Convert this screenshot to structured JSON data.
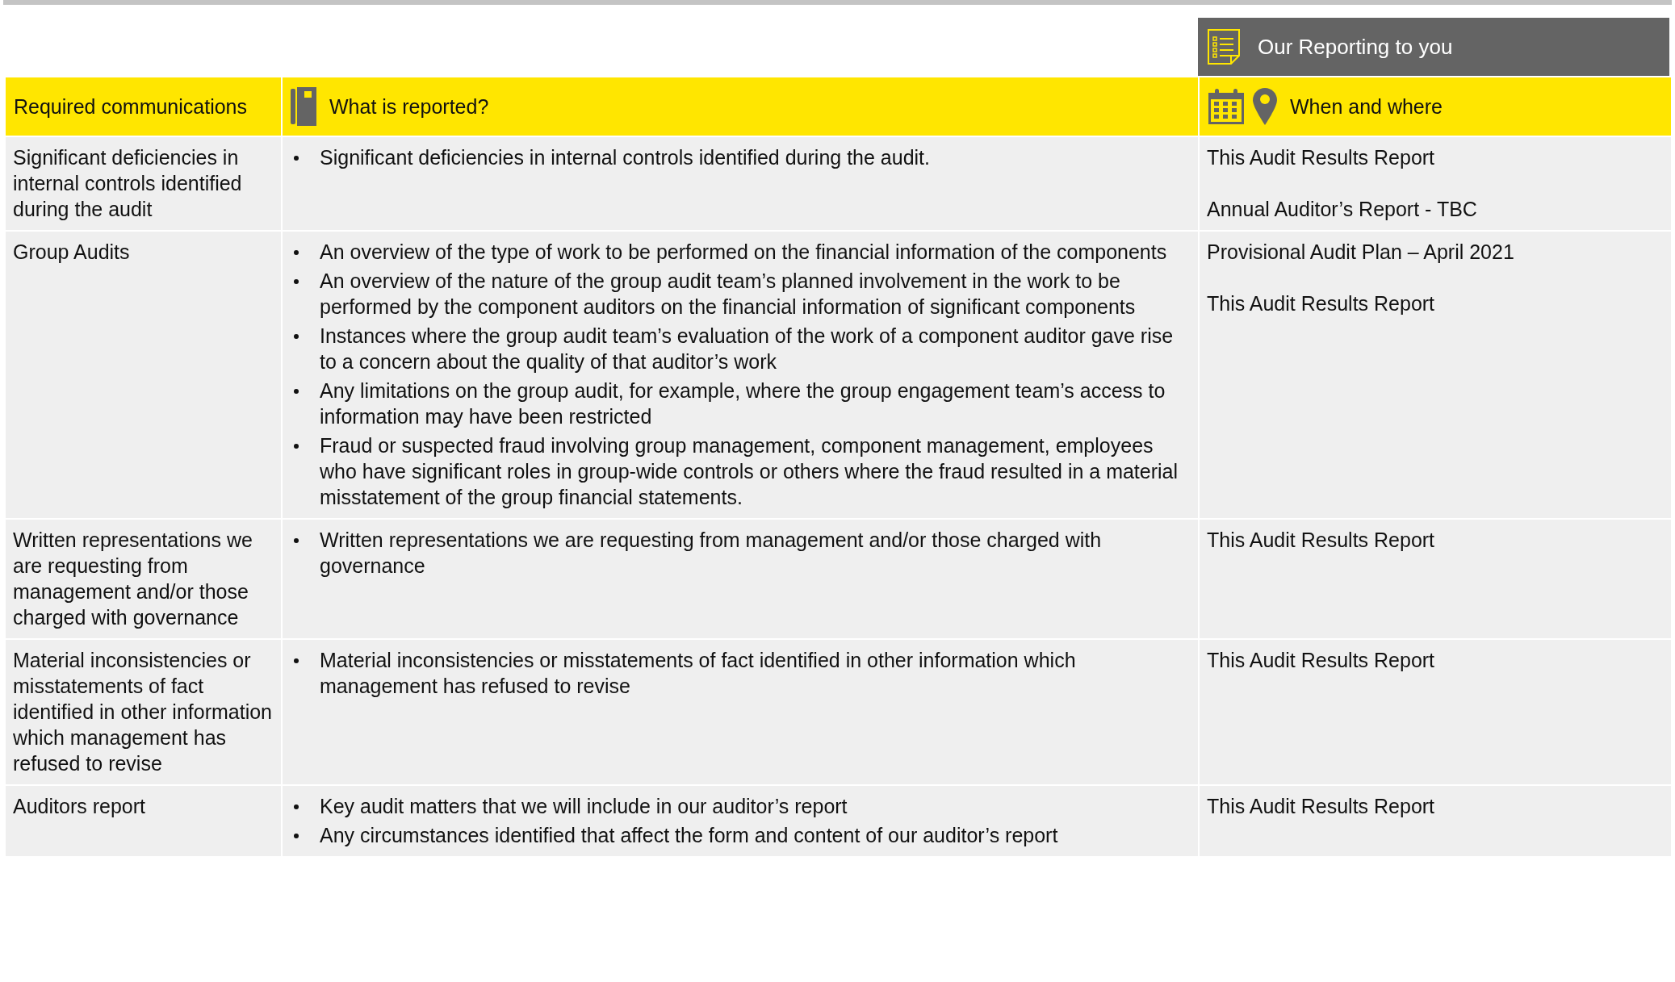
{
  "banner": {
    "title": "Our Reporting to you"
  },
  "columns": [
    {
      "label": "Required communications"
    },
    {
      "label": "What is reported?"
    },
    {
      "label": "When and where"
    }
  ],
  "rows": [
    {
      "requirement": "Significant deficiencies in internal controls identified during the audit",
      "items": [
        "Significant deficiencies in internal controls identified during the audit."
      ],
      "when": [
        "This Audit Results Report",
        "Annual Auditor’s Report - TBC"
      ]
    },
    {
      "requirement": "Group Audits",
      "items": [
        "An overview of the type of work to be performed on the financial information of the components",
        "An overview of the nature of the group audit team’s planned involvement in the work to be performed by the component auditors on the financial information of significant components",
        "Instances where the group audit team’s evaluation of the work of a component auditor gave rise to a concern about the quality of that auditor’s work",
        "Any limitations on the group audit, for example, where the group engagement team’s access to information may have been restricted",
        "Fraud or suspected fraud involving group management, component management, employees who have significant roles in group-wide controls or others where the fraud resulted in a material misstatement of the group financial statements."
      ],
      "when": [
        "Provisional Audit Plan – April 2021",
        "This Audit Results Report"
      ]
    },
    {
      "requirement": "Written representations we are requesting from management and/or those charged with governance",
      "items": [
        "Written representations we are requesting from management and/or those charged with governance"
      ],
      "when": [
        "This Audit Results Report"
      ]
    },
    {
      "requirement": "Material inconsistencies or misstatements of fact identified in other information which management has refused to revise",
      "items": [
        "Material inconsistencies or misstatements of fact identified in other information which management has refused to revise"
      ],
      "when": [
        "This Audit Results Report"
      ]
    },
    {
      "requirement": "Auditors report",
      "items": [
        "Key audit matters that we will include in our auditor’s report",
        "Any circumstances identified that affect the form and content of our auditor’s report"
      ],
      "when": [
        "This Audit Results Report"
      ]
    }
  ]
}
